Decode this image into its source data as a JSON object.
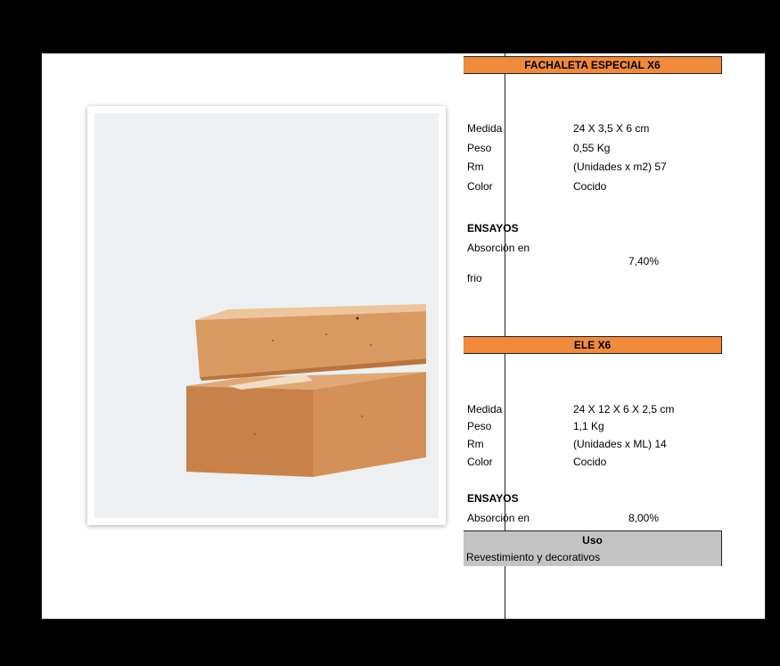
{
  "products": [
    {
      "title": "FACHALETA ESPECIAL X6",
      "specs": [
        {
          "label": "Medida",
          "value": "24 X 3,5 X 6  cm"
        },
        {
          "label": "Peso",
          "value": "0,55 Kg"
        },
        {
          "label": "Rm",
          "value": "(Unidades x m2) 57"
        },
        {
          "label": "Color",
          "value": "Cocido"
        }
      ],
      "ensayos_title": "ENSAYOS",
      "test_label_1": "Absorción en",
      "test_label_2": "frio",
      "test_value": "7,40%"
    },
    {
      "title": "ELE X6",
      "specs": [
        {
          "label": "Medida",
          "value": "24 X 12 X 6 X 2,5 cm"
        },
        {
          "label": "Peso",
          "value": "1,1 Kg"
        },
        {
          "label": "Rm",
          "value": "(Unidades x ML) 14"
        },
        {
          "label": "Color",
          "value": "Cocido"
        }
      ],
      "ensayos_title": "ENSAYOS",
      "test_label_1": "Absorción en",
      "test_value": "8,00%"
    }
  ],
  "uso": {
    "title": "Uso",
    "text": "Revestimiento y decorativos"
  },
  "colors": {
    "header_orange": "#f08a3c",
    "uso_gray": "#c4c4c4",
    "brick": "#d9955c"
  }
}
